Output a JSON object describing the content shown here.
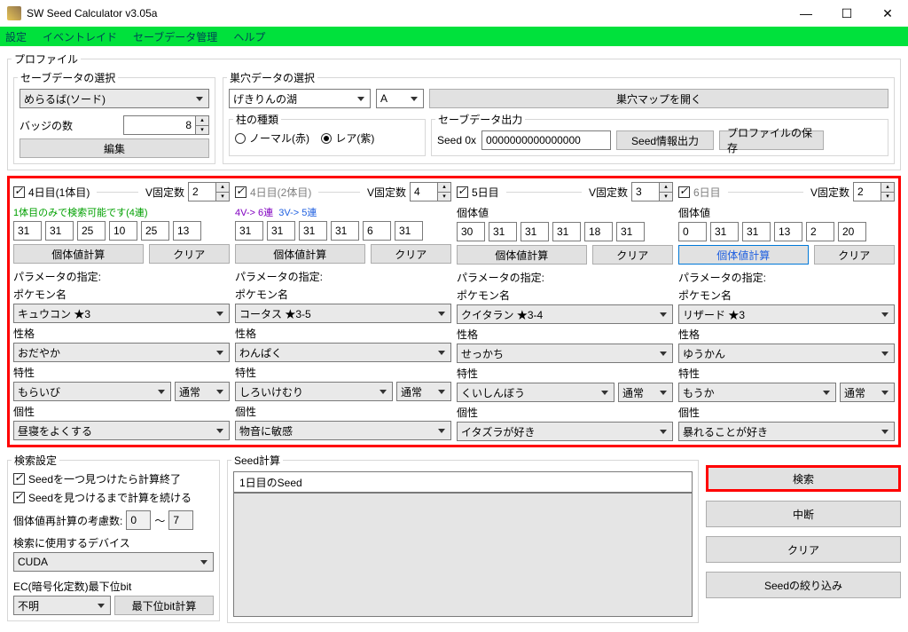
{
  "window": {
    "title": "SW Seed Calculator v3.05a"
  },
  "menu": {
    "settings": "設定",
    "eventraid": "イベントレイド",
    "savedata": "セーブデータ管理",
    "help": "ヘルプ"
  },
  "profile": {
    "legend": "プロファイル",
    "savedata": {
      "legend": "セーブデータの選択",
      "value": "めらるば(ソード)",
      "badges_label": "バッジの数",
      "badges": "8",
      "edit": "編集"
    },
    "den": {
      "legend": "巣穴データの選択",
      "loc": "げきりんの湖",
      "slot": "A",
      "openmap": "巣穴マップを開く",
      "pillar": {
        "legend": "柱の種類",
        "normal": "ノーマル(赤)",
        "rare": "レア(紫)"
      },
      "output": {
        "legend": "セーブデータ出力",
        "seed0x": "Seed 0x",
        "seed": "0000000000000000",
        "seedout": "Seed情報出力",
        "saveprofile": "プロファイルの保存"
      }
    }
  },
  "days": [
    {
      "enabled": true,
      "title": "4日目(1体目)",
      "title_gray": false,
      "vfix_label": "V固定数",
      "vfix": "2",
      "note_green": "1体目のみで検索可能です(4連)",
      "note_purple": "",
      "note_blue": "",
      "ivs": [
        "31",
        "31",
        "25",
        "10",
        "25",
        "13"
      ],
      "calc": "個体値計算",
      "clear": "クリア",
      "param_label": "パラメータの指定:",
      "poke_label": "ポケモン名",
      "poke": "キュウコン ★3",
      "nature_label": "性格",
      "nature": "おだやか",
      "ability_label": "特性",
      "ability": "もらいび",
      "ability2": "通常",
      "char_label": "個性",
      "char": "昼寝をよくする"
    },
    {
      "enabled": true,
      "title": "4日目(2体目)",
      "title_gray": true,
      "vfix_label": "V固定数",
      "vfix": "4",
      "note_green": "",
      "note_purple": "4V-> 6連",
      "note_blue": "3V-> 5連",
      "ivs": [
        "31",
        "31",
        "31",
        "31",
        "6",
        "31"
      ],
      "calc": "個体値計算",
      "clear": "クリア",
      "param_label": "パラメータの指定:",
      "poke_label": "ポケモン名",
      "poke": "コータス ★3-5",
      "nature_label": "性格",
      "nature": "わんぱく",
      "ability_label": "特性",
      "ability": "しろいけむり",
      "ability2": "通常",
      "char_label": "個性",
      "char": "物音に敏感"
    },
    {
      "enabled": true,
      "title": "5日目",
      "title_gray": false,
      "vfix_label": "V固定数",
      "vfix": "3",
      "note_green": "",
      "note_purple": "",
      "note_blue": "",
      "iv_label": "個体値",
      "ivs": [
        "30",
        "31",
        "31",
        "31",
        "18",
        "31"
      ],
      "calc": "個体値計算",
      "clear": "クリア",
      "param_label": "パラメータの指定:",
      "poke_label": "ポケモン名",
      "poke": "クイタラン ★3-4",
      "nature_label": "性格",
      "nature": "せっかち",
      "ability_label": "特性",
      "ability": "くいしんぼう",
      "ability2": "通常",
      "char_label": "個性",
      "char": "イタズラが好き"
    },
    {
      "enabled": true,
      "title": "6日目",
      "title_gray": true,
      "vfix_label": "V固定数",
      "vfix": "2",
      "note_green": "",
      "note_purple": "",
      "note_blue": "",
      "iv_label": "個体値",
      "ivs": [
        "0",
        "31",
        "31",
        "13",
        "2",
        "20"
      ],
      "calc": "個体値計算",
      "clear": "クリア",
      "calc_blue": true,
      "param_label": "パラメータの指定:",
      "poke_label": "ポケモン名",
      "poke": "リザード ★3",
      "nature_label": "性格",
      "nature": "ゆうかん",
      "ability_label": "特性",
      "ability": "もうか",
      "ability2": "通常",
      "char_label": "個性",
      "char": "暴れることが好き"
    }
  ],
  "search": {
    "legend": "検索設定",
    "stop1": "Seedを一つ見つけたら計算終了",
    "keep": "Seedを見つけるまで計算を続ける",
    "recalc_label": "個体値再計算の考慮数:",
    "recalc_from": "0",
    "recalc_sep": "～",
    "recalc_to": "7",
    "device_label": "検索に使用するデバイス",
    "device": "CUDA",
    "ec_label": "EC(暗号化定数)最下位bit",
    "ec": "不明",
    "ec_btn": "最下位bit計算"
  },
  "seedcalc": {
    "legend": "Seed計算",
    "first": "1日目のSeed"
  },
  "actions": {
    "search": "検索",
    "abort": "中断",
    "clear": "クリア",
    "narrow": "Seedの絞り込み"
  }
}
